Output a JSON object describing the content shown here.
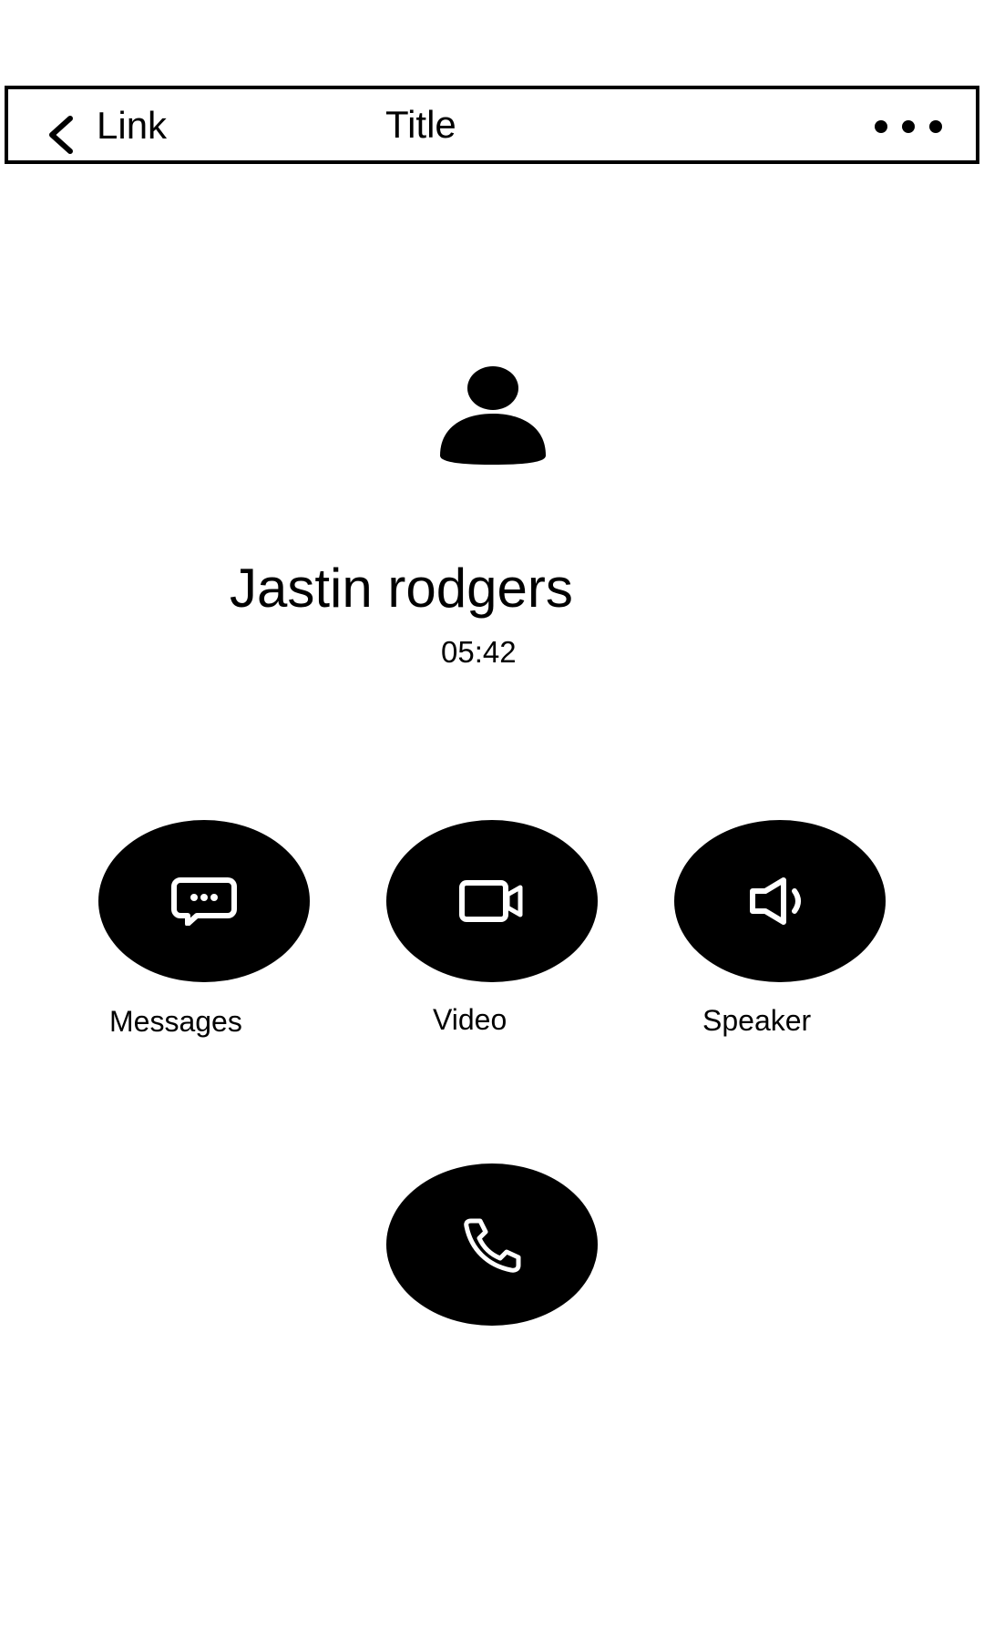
{
  "header": {
    "back_label": "Link",
    "title": "Title",
    "back_icon": "chevron-left-icon",
    "more_icon": "more-horizontal-icon"
  },
  "caller": {
    "name": "Jastin rodgers",
    "duration": "05:42",
    "avatar_icon": "user-icon"
  },
  "actions": [
    {
      "label": "Messages",
      "icon": "message-icon"
    },
    {
      "label": "Video",
      "icon": "video-camera-icon"
    },
    {
      "label": "Speaker",
      "icon": "speaker-icon"
    }
  ],
  "call_button": {
    "icon": "phone-icon"
  },
  "colors": {
    "foreground": "#000000",
    "background": "#ffffff"
  }
}
